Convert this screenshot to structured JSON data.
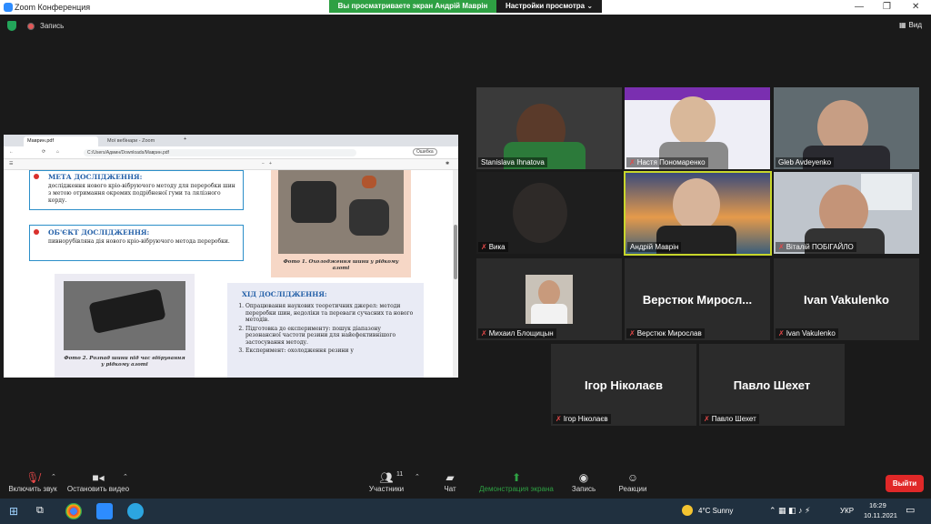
{
  "window": {
    "title": "Zoom Конференция"
  },
  "banner": {
    "sharing": "Вы просматриваете экран Андрій Маврін",
    "view_options": "Настройки просмотра"
  },
  "topbar": {
    "record": "Запись",
    "view": "Вид"
  },
  "browser": {
    "tab1": "Маврин.pdf",
    "tab2": "Мої вебінари - Zoom",
    "url": "C:/Users/Админ/Downloads/Маврин.pdf"
  },
  "pdf": {
    "goal_heading": "МЕТА ДОСЛІДЖЕННЯ:",
    "goal_text": "дослідження нового кріо-вібруючого методу для переробки шин з метою отримання окремих подрібненої гуми та лялізного корду.",
    "object_heading": "ОБ'ЄКТ ДОСЛІДЖЕННЯ:",
    "object_text": "пивнорубiвляна дiя нового крiо-вiбруючого метода переробки.",
    "photo1_caption": "Фото 1. Охолодження шини у рідкому азоті",
    "photo2_caption": "Фото 2. Розпад шини під час вібрування у рідкому азоті",
    "progress_heading": "ХІД ДОСЛІДЖЕННЯ:",
    "steps": [
      "Опрацювання наукових теоретичних джерел: методи переробки шин, недоліки та переваги сучасних та нового методів.",
      "Підготовка до експерименту: пошук діапазону резонансної частоти резини для найефективнішого застосування методу.",
      "Експеримент: охолодження резини у"
    ]
  },
  "participants": {
    "p1": "Stanislava Ihnatova",
    "p2": "Настя Пономаренко",
    "p3": "Gleb Avdeyenko",
    "p4": "Вика",
    "p5": "Андрій Маврін",
    "p6": "Віталій ПОБІГАЙЛО",
    "p7": "Михаил Блощицын",
    "p8_big": "Верстюк Миросл...",
    "p8": "Верстюк Мирослав",
    "p9_big": "Ivan Vakulenko",
    "p9": "Ivan Vakulenko",
    "p10_big": "Ігор Ніколаєв",
    "p10": "Ігор Ніколаєв",
    "p11_big": "Павло Шехет",
    "p11": "Павло Шехет"
  },
  "toolbar": {
    "unmute": "Включить звук",
    "stop_video": "Остановить видео",
    "participants": "Участники",
    "participants_count": "11",
    "chat": "Чат",
    "share": "Демонстрация экрана",
    "record": "Запись",
    "reactions": "Реакции",
    "leave": "Выйти"
  },
  "taskbar": {
    "weather": "4°C Sunny",
    "lang": "УКР",
    "time": "16:29",
    "date": "10.11.2021"
  },
  "colors": {
    "share_green": "#2ea043",
    "leave_red": "#e02828",
    "mute_red": "#e34848",
    "speaker_border": "#c7d62b"
  }
}
